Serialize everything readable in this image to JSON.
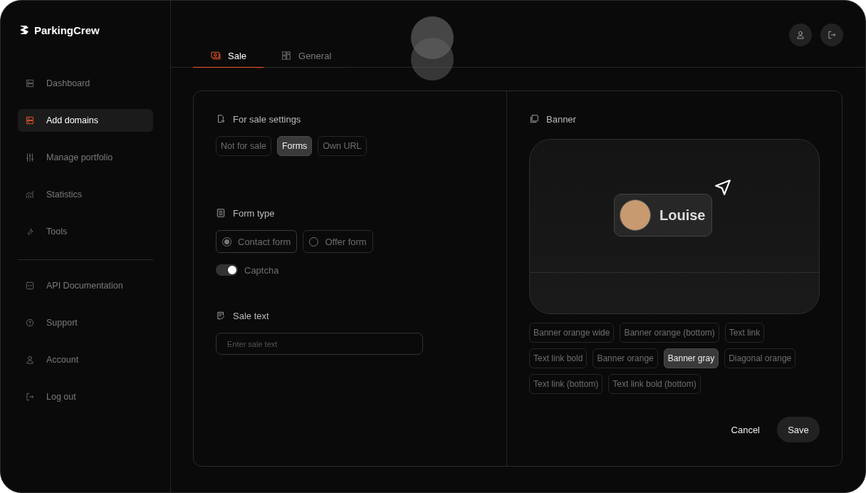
{
  "brand": {
    "name": "ParkingCrew"
  },
  "sidebar": {
    "primary_items": [
      {
        "label": "Dashboard",
        "kind": "server",
        "selected": false
      },
      {
        "label": "Add domains",
        "kind": "server",
        "selected": true
      },
      {
        "label": "Manage portfolio",
        "kind": "sliders",
        "selected": false
      },
      {
        "label": "Statistics",
        "kind": "chart",
        "selected": false
      },
      {
        "label": "Tools",
        "kind": "wrench",
        "selected": false
      }
    ],
    "secondary_items": [
      {
        "label": "API Documentation",
        "kind": "code",
        "selected": false
      },
      {
        "label": "Support",
        "kind": "help",
        "selected": false
      },
      {
        "label": "Account",
        "kind": "user",
        "selected": false
      },
      {
        "label": "Log out",
        "kind": "logout",
        "selected": false
      }
    ]
  },
  "tabs": [
    {
      "label": "Sale",
      "kind": "money",
      "selected": true
    },
    {
      "label": "General",
      "kind": "grid",
      "selected": false
    }
  ],
  "sale_settings": {
    "title": "For sale settings",
    "options": [
      {
        "label": "Not for sale",
        "selected": false
      },
      {
        "label": "Forms",
        "selected": true
      },
      {
        "label": "Own URL",
        "selected": false
      }
    ]
  },
  "form_type": {
    "title": "Form type",
    "options": [
      {
        "label": "Contact form",
        "selected": true
      },
      {
        "label": "Offer form",
        "selected": false
      }
    ],
    "toggle": {
      "label": "Captcha",
      "on": true
    }
  },
  "sale_text": {
    "title": "Sale text",
    "placeholder": "Enter sale text"
  },
  "banner": {
    "title": "Banner",
    "preview_name": "Louise",
    "styles": [
      {
        "label": "Banner orange wide",
        "selected": false
      },
      {
        "label": "Banner orange (bottom)",
        "selected": false
      },
      {
        "label": "Text link",
        "selected": false
      },
      {
        "label": "Text link bold",
        "selected": false
      },
      {
        "label": "Banner orange",
        "selected": false
      },
      {
        "label": "Banner gray",
        "selected": true
      },
      {
        "label": "Diagonal orange",
        "selected": false
      },
      {
        "label": "Text link (bottom)",
        "selected": false
      },
      {
        "label": "Text link bold (bottom)",
        "selected": false
      }
    ]
  },
  "actions": {
    "cancel": "Cancel",
    "save": "Save"
  }
}
